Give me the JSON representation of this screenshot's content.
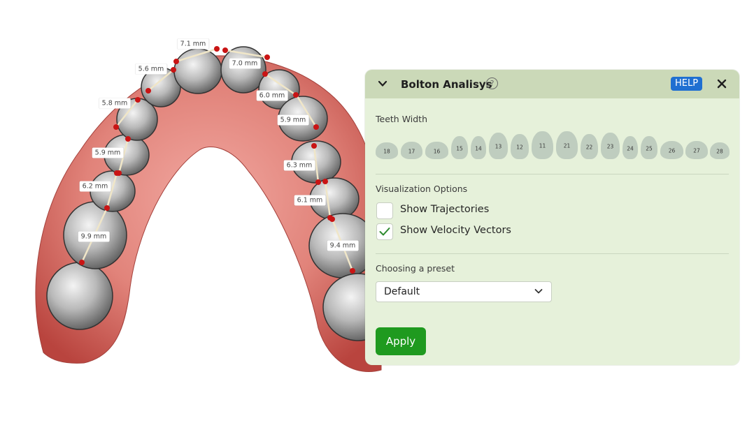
{
  "viewport": {
    "measurements": [
      "7.1 mm",
      "5.6 mm",
      "7.0 mm",
      "5.8 mm",
      "6.0 mm",
      "5.9 mm",
      "5.9 mm",
      "6.3 mm",
      "6.2 mm",
      "6.1 mm",
      "9.9 mm",
      "9.4 mm"
    ]
  },
  "panel": {
    "title": "Bolton Analisys",
    "info_glyph": "?",
    "help_label": "HELP",
    "teeth_width_label": "Teeth Width",
    "teeth": [
      "18",
      "17",
      "16",
      "15",
      "14",
      "13",
      "12",
      "11",
      "21",
      "22",
      "23",
      "24",
      "25",
      "26",
      "27",
      "28"
    ],
    "visualization_label": "Visualization Options",
    "options": [
      {
        "label": "Show Trajectories",
        "checked": false
      },
      {
        "label": "Show Velocity Vectors",
        "checked": true
      }
    ],
    "preset_label": "Choosing a preset",
    "preset_value": "Default",
    "apply_label": "Apply"
  },
  "colors": {
    "panel_bg": "#e6f1da",
    "header_bg": "#cbd9b8",
    "help_button": "#1f6fd1",
    "apply_button": "#1f9a1f",
    "check_mark": "#2d8a2d",
    "gum": "#d0675f",
    "marker": "#c91414"
  },
  "icons": {
    "collapse": "chevron-down-icon",
    "info": "question-circle-icon",
    "close": "close-icon",
    "dropdown": "chevron-down-icon",
    "check": "checkmark-icon"
  }
}
